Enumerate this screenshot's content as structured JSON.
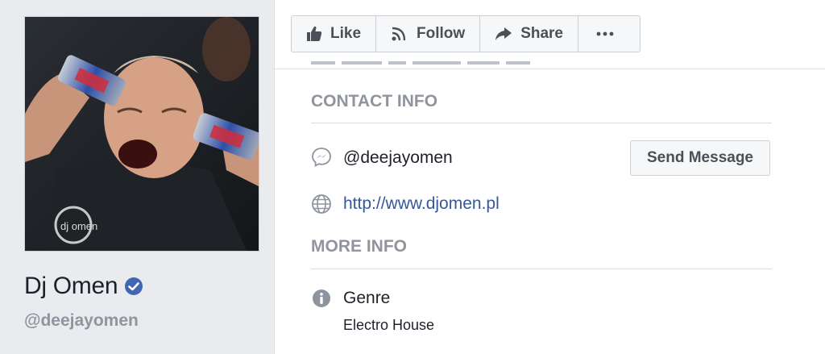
{
  "profile": {
    "name": "Dj Omen",
    "handle": "@deejayomen",
    "verified": true,
    "photo_print": "dj omen"
  },
  "actions": [
    {
      "label": "Like",
      "icon": "thumbs-up-icon"
    },
    {
      "label": "Follow",
      "icon": "rss-icon"
    },
    {
      "label": "Share",
      "icon": "share-arrow-icon"
    },
    {
      "label": "",
      "icon": "more-dots-icon"
    }
  ],
  "contact_info": {
    "title": "CONTACT INFO",
    "messenger": {
      "icon": "messenger-icon",
      "value": "@deejayomen",
      "button": "Send Message"
    },
    "website": {
      "icon": "globe-icon",
      "value": "http://www.djomen.pl"
    }
  },
  "more_info": {
    "title": "MORE INFO",
    "genre": {
      "icon": "info-icon",
      "label": "Genre",
      "value": "Electro House"
    }
  },
  "colors": {
    "link": "#365899",
    "verified": "#4267b2",
    "muted": "#90949c",
    "text": "#1d2129",
    "background": "#e9ebee"
  }
}
